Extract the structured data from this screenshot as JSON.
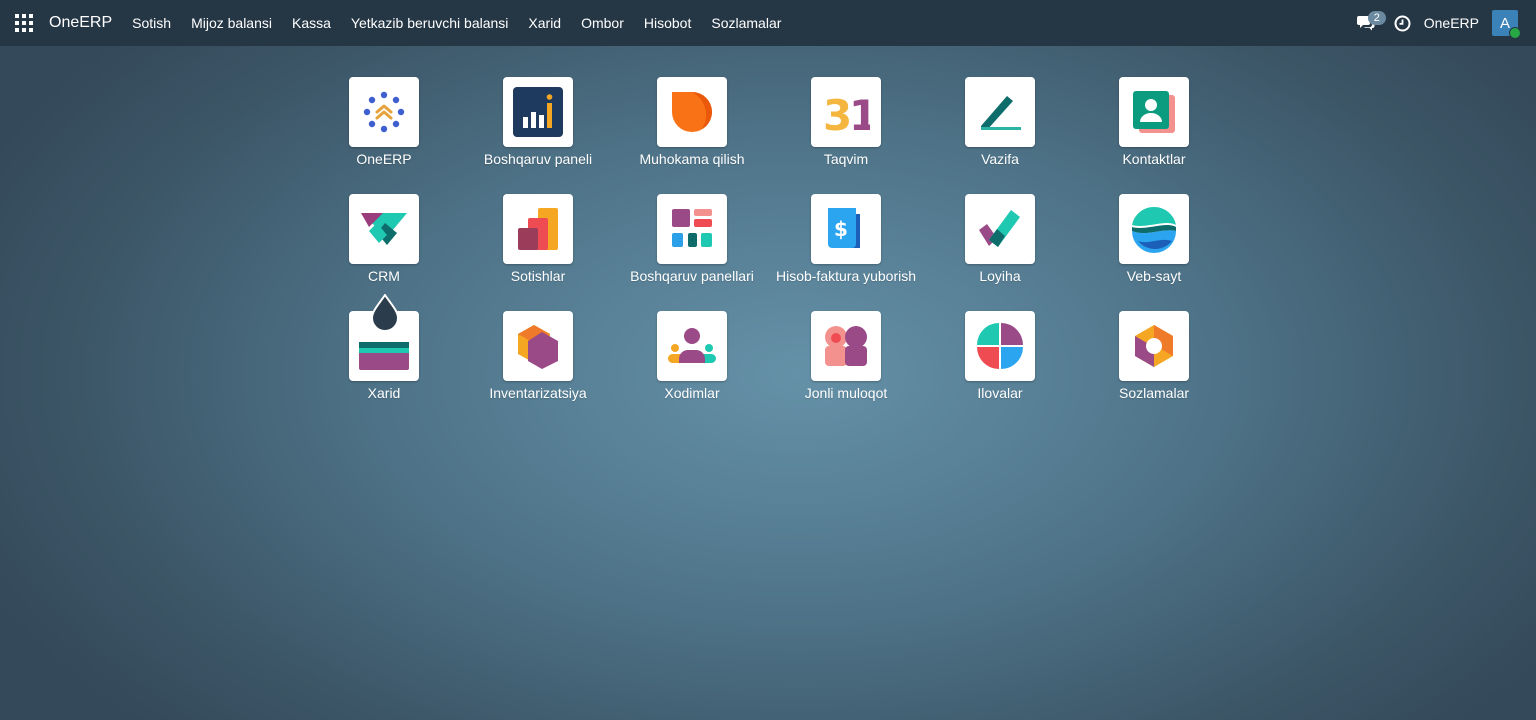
{
  "navbar": {
    "brand": "OneERP",
    "menu": [
      "Sotish",
      "Mijoz balansi",
      "Kassa",
      "Yetkazib beruvchi balansi",
      "Xarid",
      "Ombor",
      "Hisobot",
      "Sozlamalar"
    ],
    "messages_count": "2",
    "company": "OneERP",
    "user_initial": "A"
  },
  "apps": [
    {
      "label": "OneERP",
      "icon": "oneerp-icon"
    },
    {
      "label": "Boshqaruv paneli",
      "icon": "dashboard-icon"
    },
    {
      "label": "Muhokama qilish",
      "icon": "discuss-icon"
    },
    {
      "label": "Taqvim",
      "icon": "calendar-icon"
    },
    {
      "label": "Vazifa",
      "icon": "todo-icon"
    },
    {
      "label": "Kontaktlar",
      "icon": "contacts-icon"
    },
    {
      "label": "CRM",
      "icon": "crm-icon"
    },
    {
      "label": "Sotishlar",
      "icon": "sales-icon"
    },
    {
      "label": "Boshqaruv panellari",
      "icon": "dashboards-icon"
    },
    {
      "label": "Hisob-faktura yuborish",
      "icon": "invoicing-icon"
    },
    {
      "label": "Loyiha",
      "icon": "project-icon"
    },
    {
      "label": "Veb-sayt",
      "icon": "website-icon"
    },
    {
      "label": "Xarid",
      "icon": "purchase-icon"
    },
    {
      "label": "Inventarizatsiya",
      "icon": "inventory-icon"
    },
    {
      "label": "Xodimlar",
      "icon": "employees-icon"
    },
    {
      "label": "Jonli muloqot",
      "icon": "live-chat-icon"
    },
    {
      "label": "Ilovalar",
      "icon": "apps-icon"
    },
    {
      "label": "Sozlamalar",
      "icon": "settings-icon"
    }
  ]
}
